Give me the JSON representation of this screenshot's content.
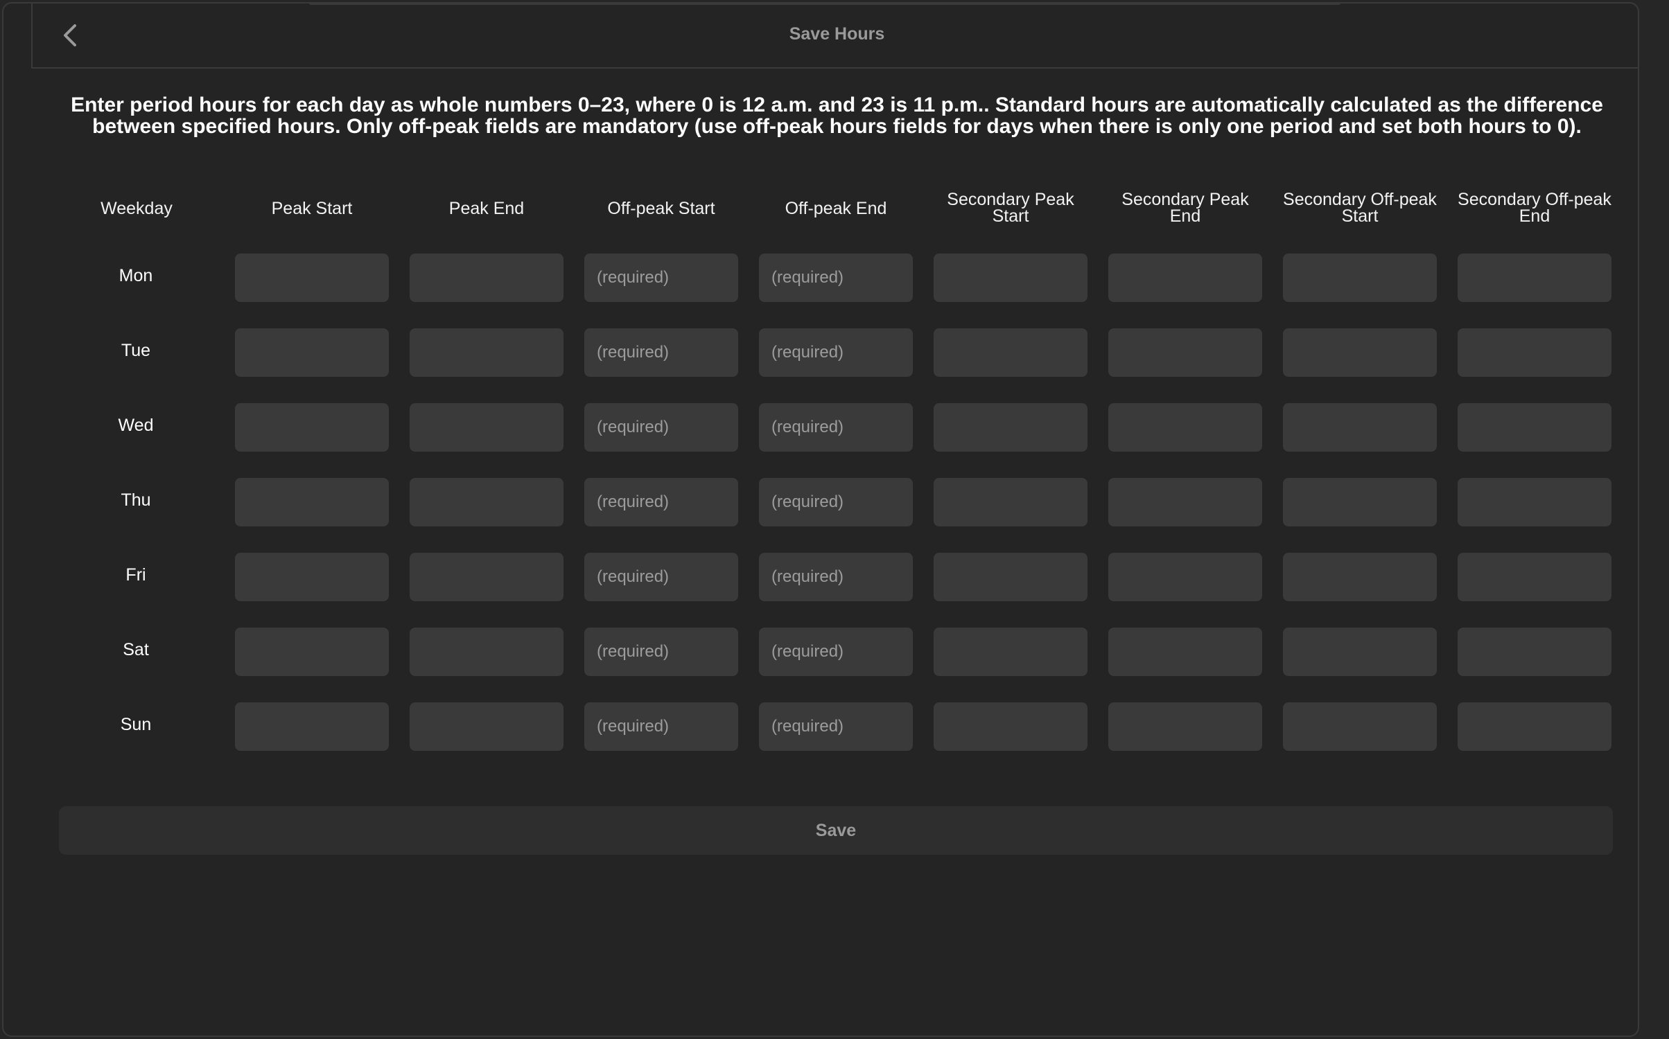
{
  "nav": {
    "title": "Save Hours",
    "back_icon": "chevron-left-icon"
  },
  "instructions": "Enter period hours for each day as whole numbers 0–23, where 0 is 12 a.m. and 23 is 11 p.m.. Standard hours are automatically calculated as the difference between specified hours. Only off-peak fields are mandatory (use off-peak hours fields for days when there is only one period and set both hours to 0).",
  "table": {
    "columns": [
      "Weekday",
      "Peak Start",
      "Peak End",
      "Off-peak Start",
      "Off-peak End",
      "Secondary Peak Start",
      "Secondary Peak End",
      "Secondary Off-peak Start",
      "Secondary Off-peak End"
    ],
    "required_placeholder": "(required)",
    "rows": [
      {
        "day": "Mon"
      },
      {
        "day": "Tue"
      },
      {
        "day": "Wed"
      },
      {
        "day": "Thu"
      },
      {
        "day": "Fri"
      },
      {
        "day": "Sat"
      },
      {
        "day": "Sun"
      }
    ]
  },
  "save_button": {
    "label": "Save"
  },
  "colors": {
    "background": "#242424",
    "input": "#3a3a3a",
    "button": "#2e2e2e",
    "muted_text": "#9a9a9a"
  }
}
